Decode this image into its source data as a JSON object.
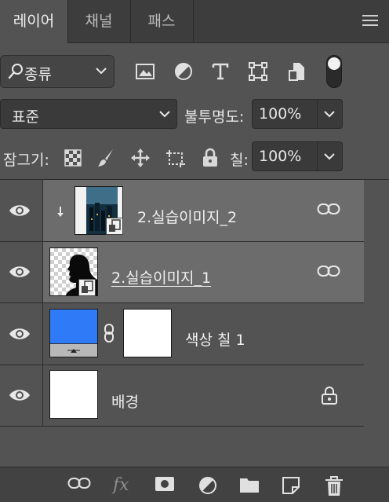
{
  "tabs": [
    {
      "label": "레이어",
      "active": true
    },
    {
      "label": "채널",
      "active": false
    },
    {
      "label": "패스",
      "active": false
    }
  ],
  "filter": {
    "kind_label": "종류"
  },
  "blend": {
    "mode": "표준",
    "opacity_label": "불투명도:",
    "opacity_value": "100%"
  },
  "locks": {
    "label": "잠그기:",
    "fill_label": "칠:",
    "fill_value": "100%"
  },
  "layers": [
    {
      "name": "2.실습이미지_2",
      "selected": true,
      "clipped": true
    },
    {
      "name": "2.실습이미지_1",
      "selected": true
    },
    {
      "name": "색상 칠 1",
      "selected": false,
      "fill_color": "#2f7bf7"
    },
    {
      "name": "배경",
      "selected": false,
      "locked": true
    }
  ],
  "colors": {
    "panel": "#535353",
    "selected_row": "#6c6c6c",
    "tabbar": "#3d3d3d",
    "fill_layer": "#2f7bf7"
  }
}
